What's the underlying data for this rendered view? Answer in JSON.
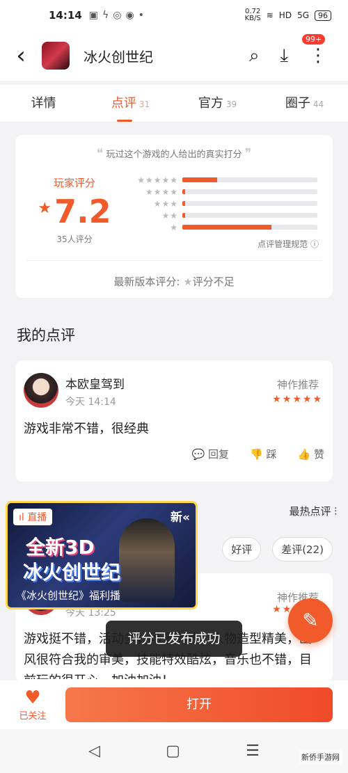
{
  "status_bar": {
    "time": "14:14",
    "speed_value": "0.72",
    "speed_unit": "KB/S",
    "signal": "5G",
    "battery": "96",
    "hd": "HD"
  },
  "header": {
    "title": "冰火创世纪",
    "notif_badge": "99+"
  },
  "tabs": [
    {
      "label": "详情",
      "count": ""
    },
    {
      "label": "点评",
      "count": "31"
    },
    {
      "label": "官方",
      "count": "39"
    },
    {
      "label": "圈子",
      "count": "44"
    }
  ],
  "rating": {
    "quote": "玩过这个游戏的人给出的真实打分",
    "label": "玩家评分",
    "score": "7.2",
    "count_text": "35人评分",
    "distribution": [
      {
        "stars": "★★★★★",
        "fraction": 0.26
      },
      {
        "stars": "★★★★",
        "fraction": 0.02
      },
      {
        "stars": "★★★",
        "fraction": 0.02
      },
      {
        "stars": "★★",
        "fraction": 0.02
      },
      {
        "stars": "★",
        "fraction": 0.66
      }
    ],
    "manage_link": "点评管理规范",
    "latest_label": "最新版本评分:",
    "latest_value": "评分不足"
  },
  "my_review": {
    "section_title": "我的点评",
    "user": "本欧皇驾到",
    "time": "今天 14:14",
    "tag": "神作推荐",
    "stars": "★★★★★",
    "content": "游戏非常不错，很经典",
    "reply": "回复",
    "dislike": "踩",
    "like": "赞"
  },
  "hot": {
    "sort_label": "最热点评",
    "filters": [
      "好评",
      "差评(22)"
    ]
  },
  "review2": {
    "time": "今天 13:25",
    "tag": "神作推荐",
    "stars": "★★★★★",
    "content": "游戏挺不错，活动多，场景别致，人物造型精美，画风很符合我的审美，技能特效酷炫，音乐也不错，目前玩的很开心，加油加油！"
  },
  "live_popup": {
    "tag": "直播",
    "new_tag": "新",
    "big1": "全新3D",
    "big2": "冰火创世纪",
    "sub": "《冰火创世纪》福利播"
  },
  "toast": "评分已发布成功",
  "bottom": {
    "follow_label": "已关注",
    "open_label": "打开"
  },
  "watermark": "新侨手游网"
}
